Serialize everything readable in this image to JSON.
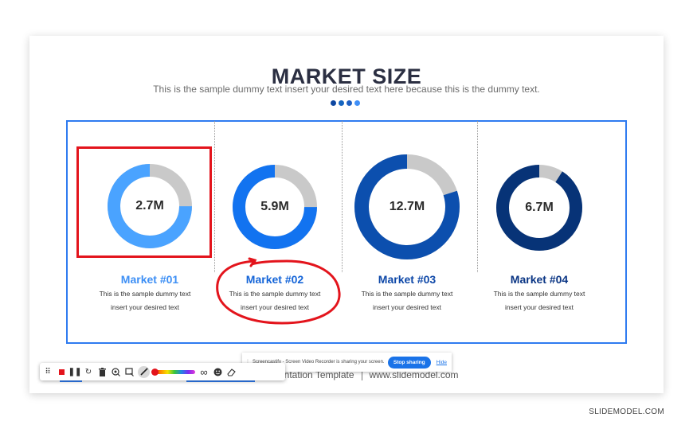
{
  "slide": {
    "title": "MARKET SIZE",
    "subtitle": "This is the sample dummy text insert your desired text here because this is the dummy text.",
    "dot_colors": [
      "#0d47a1",
      "#1565c0",
      "#1e5fc2",
      "#3f8ff7"
    ],
    "frame_color": "#2f7bf0",
    "donut_gray": "#c9c9c9",
    "markets": [
      {
        "name": "Market #01",
        "value": "2.7M",
        "color": "#4aa3ff",
        "name_color": "#3d8ff5",
        "desc1": "This is the sample dummy text",
        "desc2": "insert your desired text"
      },
      {
        "name": "Market #02",
        "value": "5.9M",
        "color": "#1273f0",
        "name_color": "#1565d8",
        "desc1": "This is the sample dummy text",
        "desc2": "insert your desired text"
      },
      {
        "name": "Market #03",
        "value": "12.7M",
        "color": "#0c4fae",
        "name_color": "#0e48a8",
        "desc1": "This is the sample dummy text",
        "desc2": "insert your desired text"
      },
      {
        "name": "Market #04",
        "value": "6.7M",
        "color": "#073377",
        "name_color": "#0a3584",
        "desc1": "This is the sample dummy text",
        "desc2": "insert your desired text"
      }
    ],
    "footer_left": "entation Template",
    "footer_right": "www.slidemodel.com"
  },
  "annotation": {
    "color": "#e3141c"
  },
  "toolbar": {
    "icons": [
      "drag-handle-icon",
      "stop-icon",
      "pause-icon",
      "restart-icon",
      "trash-icon",
      "spotlight-icon",
      "rect-select-icon",
      "magic-pen-icon",
      "color-slider",
      "infinity-icon",
      "emoji-icon",
      "eraser-icon"
    ]
  },
  "share_bar": {
    "message": "Screencastify - Screen Video Recorder is sharing your screen.",
    "stop_label": "Stop sharing",
    "hide_label": "Hide"
  },
  "brand": "SLIDEMODEL.COM"
}
